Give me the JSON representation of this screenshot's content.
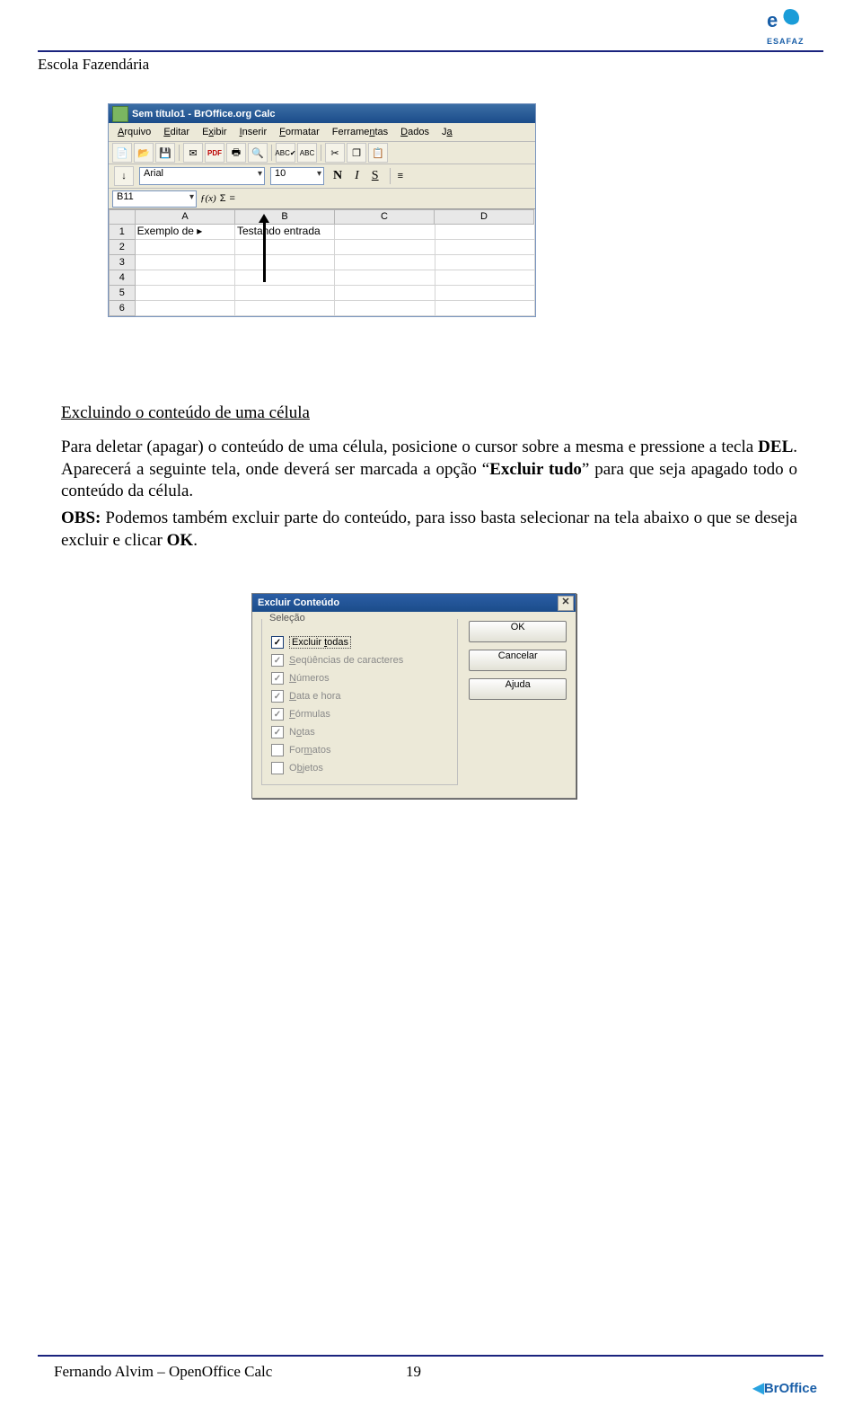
{
  "header": {
    "school": "Escola Fazendária",
    "logo_top": "e",
    "logo_text": "ESAFAZ"
  },
  "footer": {
    "author": "Fernando Alvim – OpenOffice Calc",
    "page": "19",
    "brand": "BrOffice"
  },
  "calc": {
    "title": "Sem título1 - BrOffice.org Calc",
    "menu": [
      "Arquivo",
      "Editar",
      "Exibir",
      "Inserir",
      "Formatar",
      "Ferramentas",
      "Dados",
      "Ja"
    ],
    "font": "Arial",
    "size": "10",
    "bold": "N",
    "italic": "I",
    "under": "S",
    "namebox": "B11",
    "fx": "ƒ(x)",
    "sigma": "Σ",
    "eq": "=",
    "cols": [
      "A",
      "B",
      "C",
      "D"
    ],
    "rows": [
      "1",
      "2",
      "3",
      "4",
      "5",
      "6"
    ],
    "a1": "Exemplo de ▸",
    "b1": "Testando entrada"
  },
  "body": {
    "h3": "Excluindo o conteúdo de uma célula",
    "p1": "Para deletar (apagar) o conteúdo de uma célula, posicione o cursor sobre a mesma e pressione a tecla ",
    "del": "DEL",
    "p1b": ". Aparecerá a seguinte tela, onde deverá ser marcada a opção “",
    "strong": "Excluir tudo",
    "p1c": "” para que seja apagado todo o conteúdo da célula.",
    "obs_label": "OBS:",
    "p2": " Podemos também excluir parte do conteúdo, para isso basta selecionar na tela abaixo o que se deseja excluir e clicar ",
    "ok": "OK",
    "p2b": "."
  },
  "dialog": {
    "title": "Excluir Conteúdo",
    "group": "Seleção",
    "items": [
      {
        "label": "Excluir todas",
        "checked": true,
        "enabled": true,
        "underline": "t"
      },
      {
        "label": "Seqüências de caracteres",
        "checked": true,
        "enabled": false,
        "underline": "S"
      },
      {
        "label": "Números",
        "checked": true,
        "enabled": false,
        "underline": "N"
      },
      {
        "label": "Data e hora",
        "checked": true,
        "enabled": false,
        "underline": "D"
      },
      {
        "label": "Fórmulas",
        "checked": true,
        "enabled": false,
        "underline": "F"
      },
      {
        "label": "Notas",
        "checked": true,
        "enabled": false,
        "underline": "o"
      },
      {
        "label": "Formatos",
        "checked": false,
        "enabled": false,
        "underline": "m"
      },
      {
        "label": "Objetos",
        "checked": false,
        "enabled": false,
        "underline": "b"
      }
    ],
    "buttons": [
      "OK",
      "Cancelar",
      "Ajuda"
    ]
  }
}
